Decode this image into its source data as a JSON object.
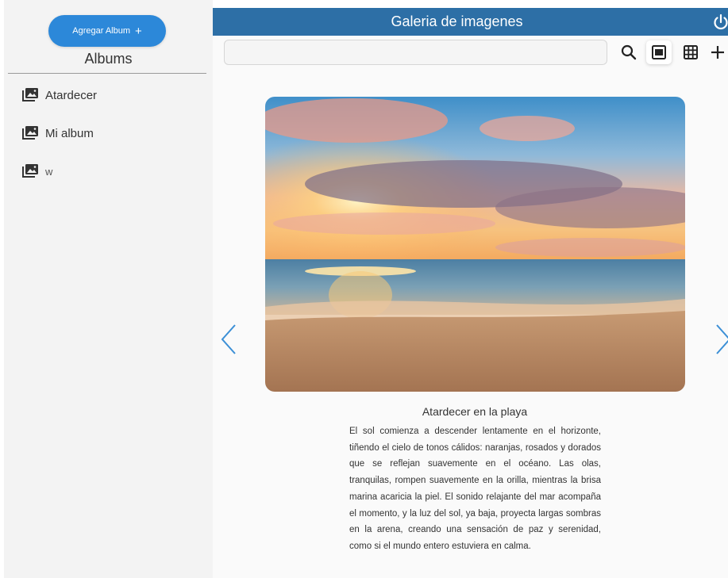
{
  "sidebar": {
    "add_button": {
      "label": "Agregar Album",
      "icon": "plus-icon"
    },
    "title": "Albums",
    "albums": [
      {
        "label": "Atardecer",
        "icon": "photo-album-icon"
      },
      {
        "label": "Mi album",
        "icon": "photo-album-icon"
      },
      {
        "label": "w",
        "icon": "photo-album-icon"
      }
    ]
  },
  "header": {
    "title": "Galeria de imagenes",
    "logout_icon": "power-icon"
  },
  "toolbar": {
    "search": {
      "value": "",
      "placeholder": ""
    },
    "tools": [
      "search-icon",
      "single-view-icon",
      "grid-view-icon",
      "add-image-icon"
    ],
    "active_tool": "single-view-icon"
  },
  "viewer": {
    "image": {
      "subject": "sunset beach"
    },
    "title": "Atardecer en la playa",
    "description": "El sol comienza a descender lentamente en el horizonte, tiñendo el cielo de tonos cálidos: naranjas, rosados y dorados que se reflejan suavemente en el océano. Las olas, tranquilas, rompen suavemente en la orilla, mientras la brisa marina acaricia la piel. El sonido relajante del mar acompaña el momento, y la luz del sol, ya baja, proyecta largas sombras en la arena, creando una sensación de paz y serenidad, como si el mundo entero estuviera en calma."
  },
  "colors": {
    "header_bg": "#2d6fa6",
    "button_bg": "#2c88d9",
    "sidebar_bg": "#f3f3f3",
    "arrow": "#3b8fd6"
  }
}
